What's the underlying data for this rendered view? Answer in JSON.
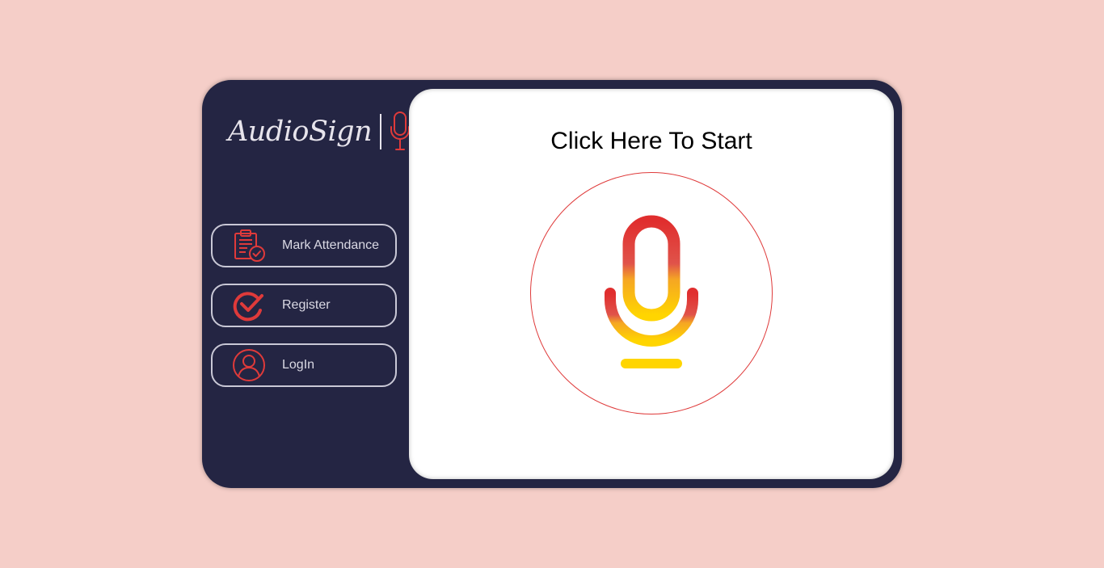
{
  "brand": {
    "name": "AudioSign",
    "logo_icon": "microphone-icon"
  },
  "nav": {
    "items": [
      {
        "id": "mark-attendance",
        "label": "Mark Attendance",
        "icon": "clipboard-check-icon"
      },
      {
        "id": "register",
        "label": "Register",
        "icon": "check-circle-icon"
      },
      {
        "id": "login",
        "label": "LogIn",
        "icon": "user-circle-icon"
      }
    ]
  },
  "main": {
    "title": "Click Here To Start",
    "mic_icon": "microphone-icon"
  },
  "colors": {
    "background": "#f5cec8",
    "card": "#242543",
    "panel": "#ffffff",
    "accent_red": "#df3a3a",
    "accent_yellow": "#ffd500"
  }
}
